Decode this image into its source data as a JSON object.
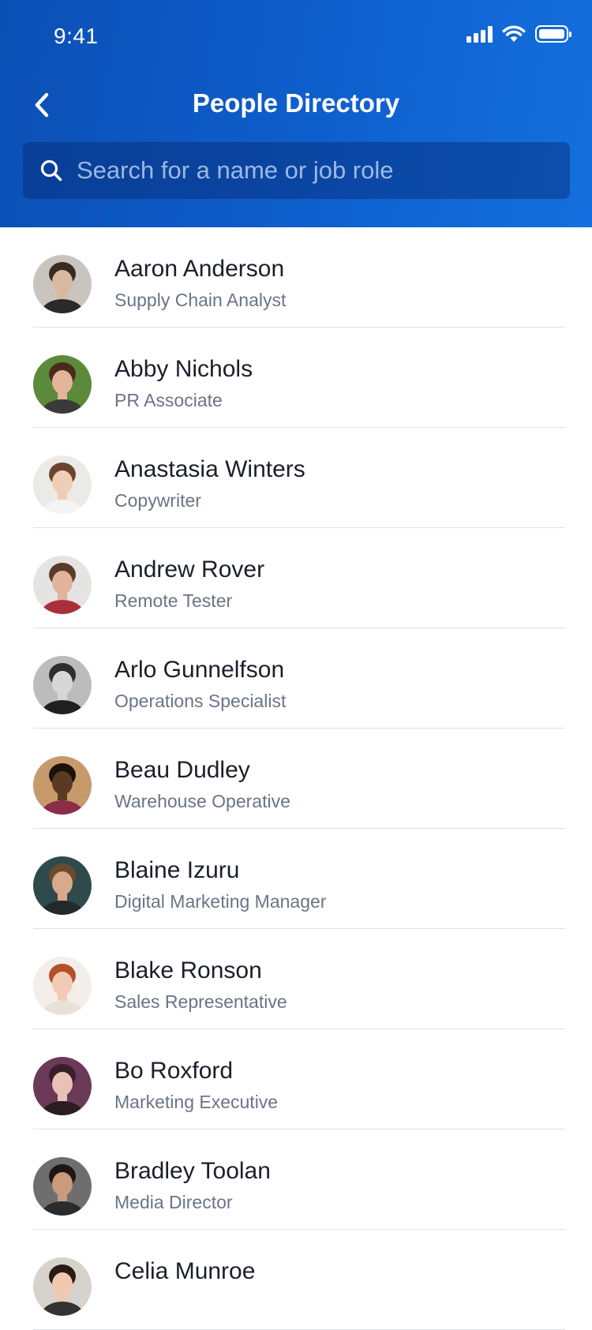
{
  "status_bar": {
    "time": "9:41"
  },
  "header": {
    "title": "People Directory",
    "search_placeholder": "Search for a name or job role"
  },
  "people": [
    {
      "name": "Aaron Anderson",
      "role": "Supply Chain Analyst",
      "skin": "#d9b8a0",
      "hair": "#3a2a22",
      "bg": "#c9c4bd",
      "shirt": "#2a2a2a"
    },
    {
      "name": "Abby Nichols",
      "role": "PR Associate",
      "skin": "#e3b49a",
      "hair": "#4a2c1e",
      "bg": "#5c8a3a",
      "shirt": "#3a3a3a"
    },
    {
      "name": "Anastasia Winters",
      "role": "Copywriter",
      "skin": "#f0cdb6",
      "hair": "#6b4530",
      "bg": "#eceae6",
      "shirt": "#f4f4f4"
    },
    {
      "name": "Andrew Rover",
      "role": "Remote Tester",
      "skin": "#e1b39a",
      "hair": "#5a3b28",
      "bg": "#e6e4e2",
      "shirt": "#a8303a"
    },
    {
      "name": "Arlo Gunnelfson",
      "role": "Operations Specialist",
      "skin": "#d7d7d7",
      "hair": "#2e2e2e",
      "bg": "#bcbcbc",
      "shirt": "#202020"
    },
    {
      "name": "Beau Dudley",
      "role": "Warehouse Operative",
      "skin": "#5b3a24",
      "hair": "#1c120b",
      "bg": "#c79a6c",
      "shirt": "#8a2c4a"
    },
    {
      "name": "Blaine Izuru",
      "role": "Digital Marketing Manager",
      "skin": "#d9a98c",
      "hair": "#6a4a30",
      "bg": "#2f4a4a",
      "shirt": "#222a2a"
    },
    {
      "name": "Blake Ronson",
      "role": "Sales Representative",
      "skin": "#f1cbb5",
      "hair": "#b3502a",
      "bg": "#f3eee9",
      "shirt": "#e8e1da"
    },
    {
      "name": "Bo Roxford",
      "role": "Marketing Executive",
      "skin": "#e8c2b6",
      "hair": "#3a1f2a",
      "bg": "#6b3a58",
      "shirt": "#2c1c24"
    },
    {
      "name": "Bradley Toolan",
      "role": "Media Director",
      "skin": "#c99a7c",
      "hair": "#1e1612",
      "bg": "#6e6e6e",
      "shirt": "#2b2b2b"
    },
    {
      "name": "Celia Munroe",
      "role": "",
      "skin": "#f0c8b0",
      "hair": "#2a1a14",
      "bg": "#d8d2cc",
      "shirt": "#333333"
    }
  ]
}
